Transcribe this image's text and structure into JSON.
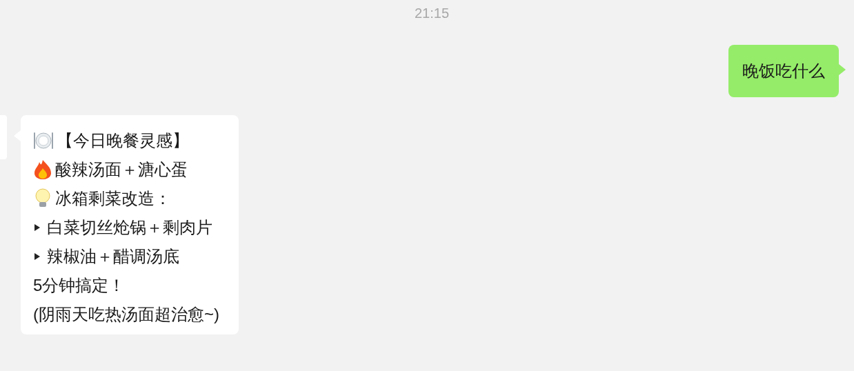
{
  "time": "21:15",
  "messages": [
    {
      "kind": "sent",
      "lines": [
        {
          "kind": "plain",
          "text": "晚饭吃什么"
        }
      ]
    },
    {
      "kind": "received",
      "lines": [
        {
          "kind": "plate",
          "text": "【今日晚餐灵感】"
        },
        {
          "kind": "fire",
          "text": "酸辣汤面＋溏心蛋"
        },
        {
          "kind": "bulb",
          "text": "冰箱剩菜改造："
        },
        {
          "kind": "bullet",
          "text": "白菜切丝炝锅＋剩肉片"
        },
        {
          "kind": "bullet",
          "text": "辣椒油＋醋调汤底"
        },
        {
          "kind": "plain",
          "text": "5分钟搞定！"
        },
        {
          "kind": "plain",
          "text": "(阴雨天吃热汤面超治愈~)"
        }
      ]
    }
  ]
}
